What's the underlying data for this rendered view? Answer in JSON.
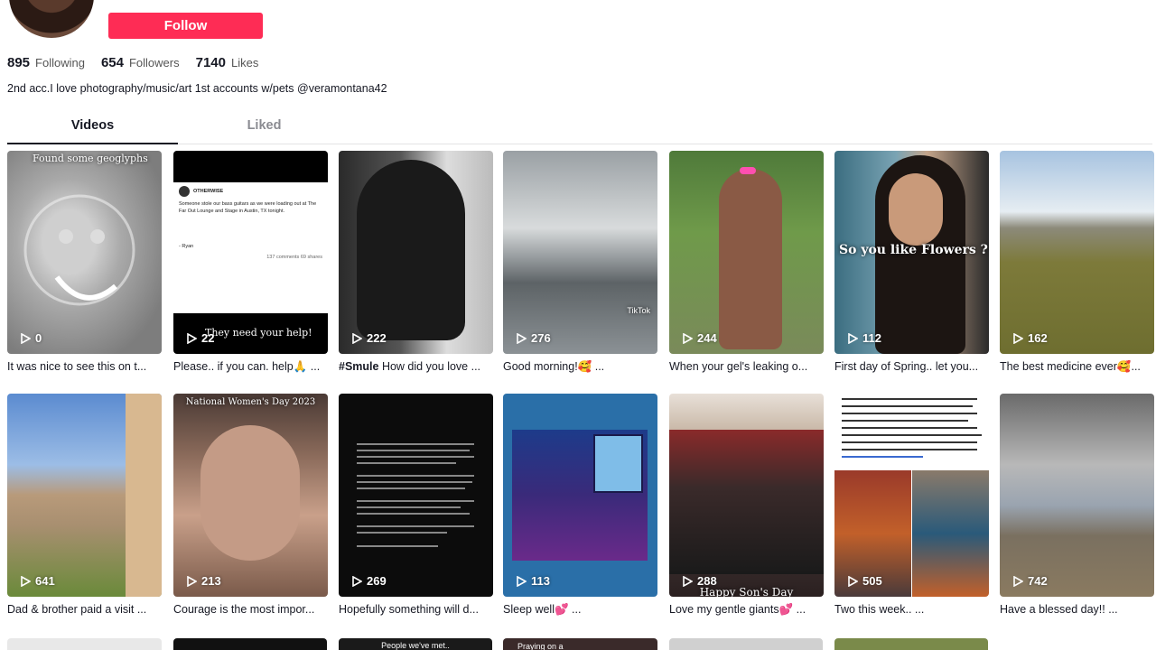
{
  "profile": {
    "follow_label": "Follow",
    "stats": [
      {
        "num": "895",
        "label": "Following"
      },
      {
        "num": "654",
        "label": "Followers"
      },
      {
        "num": "7140",
        "label": "Likes"
      }
    ],
    "bio": "2nd acc.I love photography/music/art 1st accounts w/pets @veramontana42"
  },
  "tabs": {
    "videos": "Videos",
    "liked": "Liked"
  },
  "videos": [
    {
      "views": "0",
      "caption": "It was nice to see this on t...",
      "overlay": "Found some geoglyphs"
    },
    {
      "views": "22",
      "caption": "Please.. if you can. help🙏 ...",
      "overlay": "They need your help!"
    },
    {
      "views": "222",
      "caption_bold": "#Smule",
      "caption": " How did you love ..."
    },
    {
      "views": "276",
      "caption": "Good morning!🥰 ...",
      "overlay": "TikTok"
    },
    {
      "views": "244",
      "caption": "When your gel's leaking o..."
    },
    {
      "views": "112",
      "caption": "First day of Spring.. let you...",
      "overlay": "So you like Flowers ?"
    },
    {
      "views": "162",
      "caption": "The best medicine ever🥰..."
    },
    {
      "views": "641",
      "caption": "Dad & brother paid a visit ..."
    },
    {
      "views": "213",
      "caption": "Courage is the most impor...",
      "overlay": "National Women's Day 2023"
    },
    {
      "views": "269",
      "caption": "Hopefully something will d..."
    },
    {
      "views": "113",
      "caption": "Sleep well💕 ..."
    },
    {
      "views": "288",
      "caption": "Love my gentle giants💕 ...",
      "overlay": "Happy Son's Day"
    },
    {
      "views": "505",
      "caption": "Two this week.. ..."
    },
    {
      "views": "742",
      "caption": "Have a blessed day!! ..."
    }
  ],
  "post": {
    "author": "OTHERWISE",
    "body": "Someone stole our bass guitars as we were loading out at The Far Out Lounge and Stage in Austin, TX tonight.",
    "sign": "- Ryan",
    "counts": "137 comments  69 shares"
  },
  "third_row": {
    "item3": "People we've met..",
    "item4": "Praying on a"
  },
  "colors": {
    "accent": "#fe2c55",
    "text": "#161823",
    "muted": "#8a8b91"
  }
}
